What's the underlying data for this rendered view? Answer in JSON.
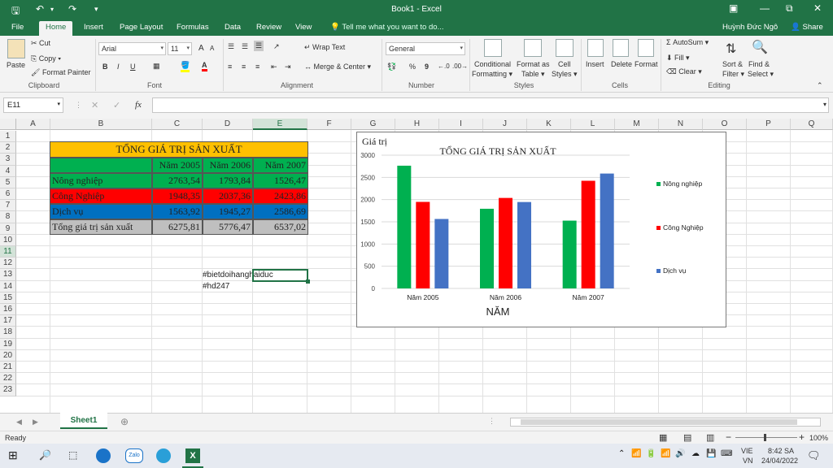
{
  "window": {
    "title": "Book1 - Excel",
    "user": "Huỳnh Đức Ngô",
    "share": "Share"
  },
  "tabs": [
    "File",
    "Home",
    "Insert",
    "Page Layout",
    "Formulas",
    "Data",
    "Review",
    "View"
  ],
  "tell_me": "Tell me what you want to do...",
  "ribbon": {
    "clipboard": {
      "paste": "Paste",
      "cut": "Cut",
      "copy": "Copy",
      "format_painter": "Format Painter",
      "label": "Clipboard"
    },
    "font": {
      "name": "Arial",
      "size": "11",
      "bold": "B",
      "italic": "I",
      "underline": "U",
      "grow": "A",
      "shrink": "A",
      "label": "Font"
    },
    "alignment": {
      "wrap": "Wrap Text",
      "merge": "Merge & Center",
      "label": "Alignment"
    },
    "number": {
      "format": "General",
      "percent": "%",
      "comma": "9",
      "label": "Number"
    },
    "styles": {
      "conditional": "Conditional",
      "conditional2": "Formatting",
      "format_table": "Format as",
      "format_table2": "Table",
      "cell_styles": "Cell",
      "cell_styles2": "Styles",
      "label": "Styles"
    },
    "cells": {
      "insert": "Insert",
      "delete": "Delete",
      "format": "Format",
      "label": "Cells"
    },
    "editing": {
      "autosum": "AutoSum",
      "fill": "Fill",
      "clear": "Clear",
      "sort": "Sort &",
      "sort2": "Filter",
      "find": "Find &",
      "find2": "Select",
      "label": "Editing"
    }
  },
  "formula_bar": {
    "name_box": "E11",
    "fx": "fx",
    "value": ""
  },
  "columns": [
    "A",
    "B",
    "C",
    "D",
    "E",
    "F",
    "G",
    "H",
    "I",
    "J",
    "K",
    "L",
    "M",
    "N",
    "O",
    "P",
    "Q"
  ],
  "rows": [
    "1",
    "2",
    "3",
    "4",
    "5",
    "6",
    "7",
    "8",
    "9",
    "10",
    "11",
    "12",
    "13",
    "14",
    "15",
    "16",
    "17",
    "18",
    "19",
    "20",
    "21",
    "22",
    "23"
  ],
  "table": {
    "title": "TỔNG GIÁ TRỊ SẢN XUẤT",
    "headers": [
      "Năm 2005",
      "Năm 2006",
      "Năm 2007"
    ],
    "rows": [
      {
        "label": "Nông nghiệp",
        "values": [
          "2763,54",
          "1793,84",
          "1526,47"
        ],
        "color": "#00b050"
      },
      {
        "label": "Công Nghiệp",
        "values": [
          "1948,35",
          "2037,36",
          "2423,86"
        ],
        "color": "#ff0000"
      },
      {
        "label": "Dịch vụ",
        "values": [
          "1563,92",
          "1945,27",
          "2586,69"
        ],
        "color": "#0070c0"
      },
      {
        "label": "Tổng giá trị sản xuất",
        "values": [
          "6275,81",
          "5776,47",
          "6537,02"
        ],
        "color": "#bfbfbf"
      }
    ],
    "title_color": "#ffc000"
  },
  "hashtags": [
    "#bietdoihanghaiduc",
    "#hd247"
  ],
  "chart_data": {
    "type": "bar",
    "title": "TỔNG GIÁ TRỊ SẢN XUẤT",
    "ylabel": "Giá trị",
    "xlabel": "NĂM",
    "categories": [
      "Năm 2005",
      "Năm 2006",
      "Năm 2007"
    ],
    "series": [
      {
        "name": "Nông nghiệp",
        "values": [
          2763.54,
          1793.84,
          1526.47
        ],
        "color": "#00b050"
      },
      {
        "name": "Công Nghiệp",
        "values": [
          1948.35,
          2037.36,
          2423.86
        ],
        "color": "#ff0000"
      },
      {
        "name": "Dịch vụ",
        "values": [
          1563.92,
          1945.27,
          2586.69
        ],
        "color": "#4472c4"
      }
    ],
    "ylim": [
      0,
      3000
    ],
    "yticks": [
      "0",
      "500",
      "1000",
      "1500",
      "2000",
      "2500",
      "3000"
    ],
    "legend": "right",
    "grid": true
  },
  "sheet": {
    "tab": "Sheet1"
  },
  "status": {
    "ready": "Ready",
    "zoom": "100%"
  },
  "taskbar": {
    "lang1": "VIE",
    "lang2": "VN",
    "time": "8:42 SA",
    "date": "24/04/2022"
  }
}
